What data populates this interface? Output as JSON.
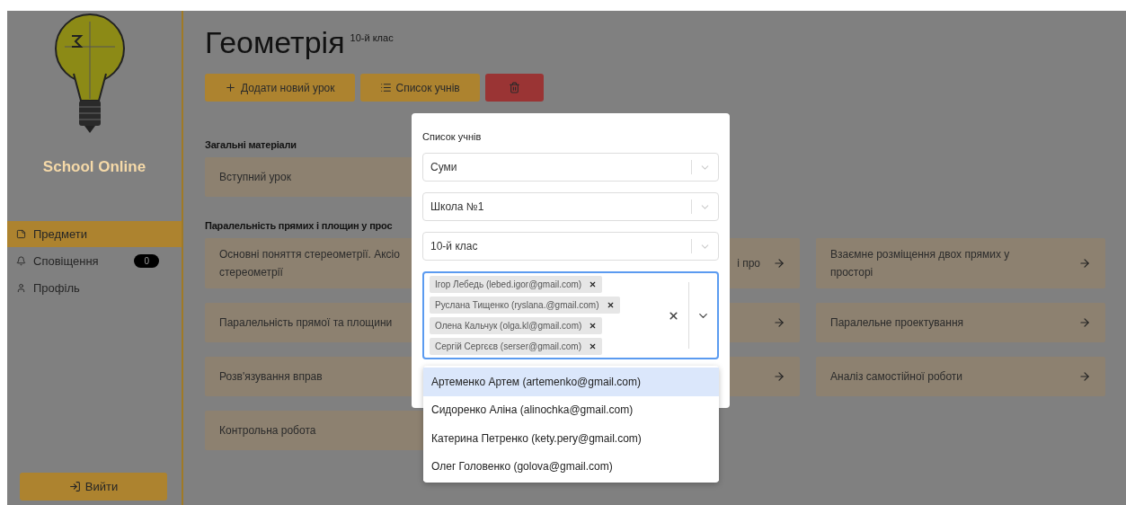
{
  "sidebar": {
    "brand": "School Online",
    "nav": [
      {
        "kind": "subjects",
        "label": "Предмети",
        "selected": true
      },
      {
        "kind": "notifications",
        "label": "Сповіщення",
        "selected": false,
        "badge": "0"
      },
      {
        "kind": "profile",
        "label": "Профіль",
        "selected": false
      }
    ],
    "logout": "Вийти"
  },
  "header": {
    "title": "Геометрія",
    "grade": "10-й клас",
    "buttons": [
      {
        "kind": "add",
        "label": "Додати новий урок"
      },
      {
        "kind": "list",
        "label": "Список учнів"
      },
      {
        "kind": "delete"
      }
    ]
  },
  "sections": [
    {
      "title": "Загальні матеріали",
      "lessons": [
        {
          "lines": [
            "Вступний урок"
          ],
          "arrow": false
        }
      ]
    },
    {
      "title": "Паралельність прямих і площин у прос",
      "lessons": [
        {
          "lines": [
            "Основні поняття стереометрії. Аксіо",
            "стереометрії"
          ],
          "arrow": false
        },
        {
          "lines": [
            "і про"
          ],
          "arrow": true
        },
        {
          "lines": [
            "Взаємне розміщення двох прямих у",
            "просторі"
          ],
          "arrow": true
        },
        {
          "lines": [
            "Паралельність прямої та площини"
          ],
          "arrow": false
        },
        {
          "arrow": true
        },
        {
          "lines": [
            "Паралельне проектування"
          ],
          "arrow": true
        },
        {
          "lines": [
            "Розв'язування вправ"
          ],
          "arrow": false
        },
        {
          "arrow": true
        },
        {
          "lines": [
            "Аналіз самостійної роботи"
          ],
          "arrow": true
        },
        {
          "lines": [
            "Контрольна робота"
          ],
          "arrow": false
        }
      ]
    }
  ],
  "modal": {
    "title": "Список учнів",
    "selects": [
      {
        "value": "Суми"
      },
      {
        "value": "Школа №1"
      },
      {
        "value": "10-й клас"
      }
    ],
    "students": [
      "Ігор Лебедь (lebed.igor@gmail.com)",
      "Руслана Тищенко (ryslana.@gmail.com)",
      "Олена Кальчук (olga.kl@gmail.com)",
      "Сергій Сергєєв (serser@gmail.com)"
    ],
    "options": [
      {
        "label": "Артеменко Артем (artemenko@gmail.com)",
        "selected": true
      },
      {
        "label": "Сидоренко Аліна (alinochka@gmail.com)",
        "selected": false
      },
      {
        "label": "Катерина Петренко (kety.pery@gmail.com)",
        "selected": false
      },
      {
        "label": "Олег Головенко (golova@gmail.com)",
        "selected": false
      }
    ]
  }
}
